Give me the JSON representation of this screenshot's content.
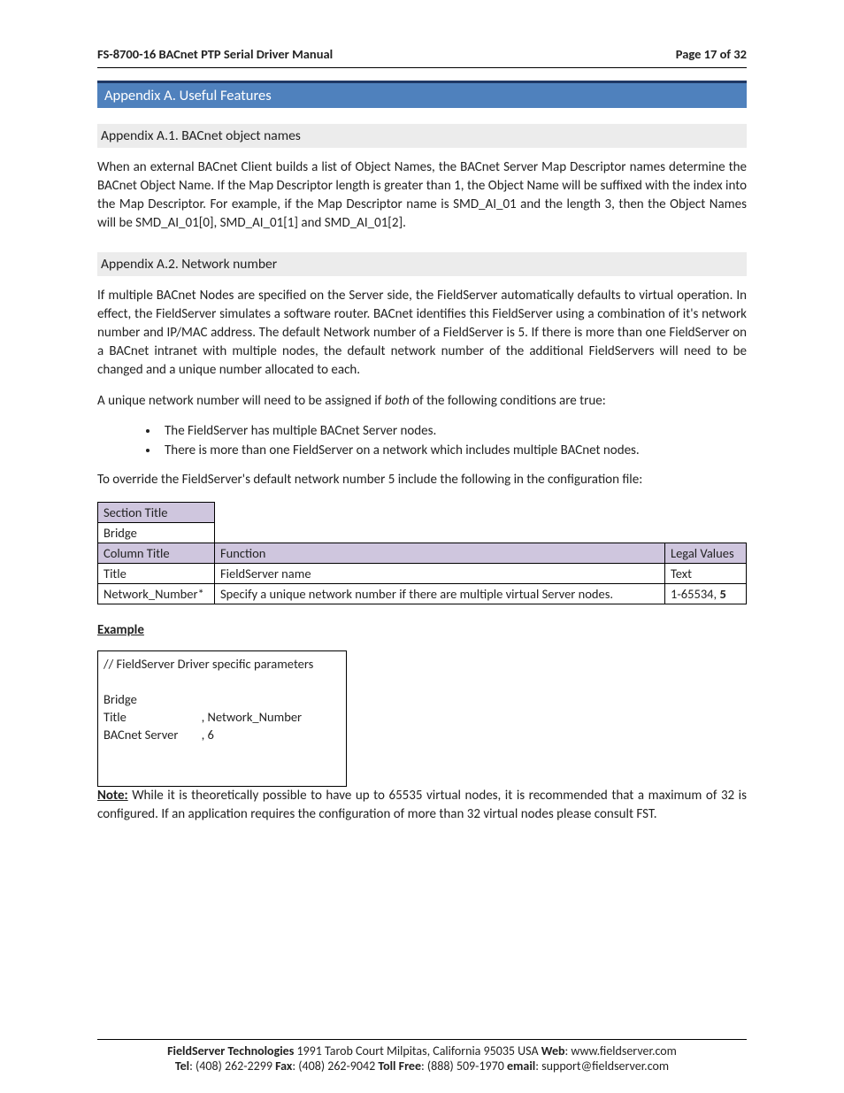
{
  "header": {
    "title": "FS-8700-16 BACnet PTP Serial Driver Manual",
    "page": "Page 17 of 32"
  },
  "appendixA": {
    "title": "Appendix A. Useful Features"
  },
  "a1": {
    "title": "Appendix A.1. BACnet object names",
    "p1": "When an external BACnet Client builds a list of Object Names, the BACnet Server Map Descriptor names determine the BACnet Object Name.  If the Map Descriptor length is greater than 1, the Object Name will be suffixed with the index into the Map Descriptor. For example, if the Map Descriptor name is SMD_AI_01 and the length 3, then the Object Names will be SMD_AI_01[0], SMD_AI_01[1] and SMD_AI_01[2]."
  },
  "a2": {
    "title": "Appendix A.2. Network number",
    "p1": "If multiple BACnet Nodes are specified on the Server side, the FieldServer automatically defaults to virtual operation.  In effect, the FieldServer simulates a software router.  BACnet identifies this FieldServer using a combination of it's network number and IP/MAC address.  The default Network number of a FieldServer is 5.  If there is more than one FieldServer on a BACnet intranet with multiple nodes, the default network number of the additional FieldServers will need to be changed and a unique number allocated to each.",
    "p2_pre": "A unique network number will need to be assigned if ",
    "p2_em": "both",
    "p2_post": " of the following conditions are true:",
    "bullets": [
      "The FieldServer has multiple BACnet Server nodes.",
      "There is more than one FieldServer on a network which includes multiple BACnet nodes."
    ],
    "p3": "To override the FieldServer's default network number 5 include the following in the configuration file:"
  },
  "table": {
    "r1c1": "Section Title",
    "r2c1": "Bridge",
    "r3c1": "Column Title",
    "r3c2": "Function",
    "r3c3": "Legal Values",
    "r4c1": "Title",
    "r4c2": "FieldServer name",
    "r4c3": "Text",
    "r5c1": "Network_Number*",
    "r5c2": "Specify a unique network number if there are multiple virtual Server nodes.",
    "r5c3_a": "1-65534, ",
    "r5c3_b": "5"
  },
  "example": {
    "label": "Example",
    "comment": "//     FieldServer Driver specific parameters",
    "l1a": "Bridge",
    "l2a": "Title",
    "l2b": ", Network_Number",
    "l3a": "BACnet Server",
    "l3b": ", 6"
  },
  "note": {
    "label": "Note:",
    "text": " While it is theoretically possible to have up to 65535 virtual nodes, it is recommended that a maximum of 32 is configured.  If an application requires the configuration of more than 32 virtual nodes please consult FST."
  },
  "footer": {
    "company": "FieldServer Technologies",
    "addr": " 1991 Tarob Court Milpitas, California 95035 USA   ",
    "web_l": "Web",
    "web_v": ": www.fieldserver.com",
    "tel_l": "Tel",
    "tel_v": ": (408) 262-2299   ",
    "fax_l": "Fax",
    "fax_v": ": (408) 262-9042   ",
    "tf_l": "Toll Free",
    "tf_v": ": (888) 509-1970   ",
    "em_l": "email",
    "em_v": ": support@fieldserver.com"
  }
}
